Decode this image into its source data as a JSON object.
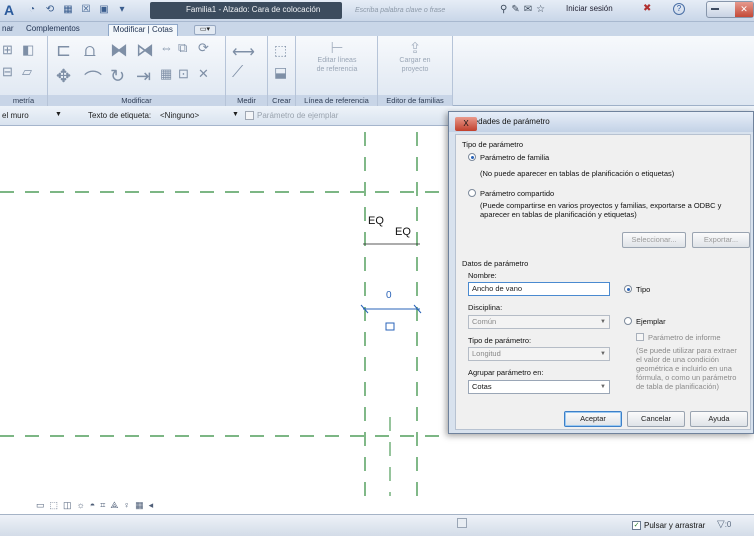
{
  "titlebar": {
    "app_letter": "A",
    "document_title": "Familia1 - Alzado: Cara de colocación",
    "search_placeholder": "Escriba palabra clave o frase",
    "signin_label": "Iniciar sesión",
    "help_label": "?"
  },
  "ribbon": {
    "tabs": [
      "nar",
      "Complementos",
      "Modificar | Cotas"
    ],
    "panels": [
      "metría",
      "Modificar",
      "Medir",
      "Crear",
      "Línea de referencia",
      "Editor de familias"
    ],
    "edit_lines_label_1": "Editar líneas",
    "edit_lines_label_2": "de referencia",
    "load_project_label_1": "Cargar en",
    "load_project_label_2": "proyecto"
  },
  "options_bar": {
    "first_select": "el muro",
    "label_text_label": "Texto de etiqueta:",
    "label_text_value": "<Ninguno>",
    "instance_param_label": "Parámetro de ejemplar"
  },
  "canvas": {
    "eq_label_1": "EQ",
    "eq_label_2": "EQ",
    "dim_value": "0"
  },
  "dialog": {
    "title": "Propiedades de parámetro",
    "close_label": "X",
    "param_type_group": "Tipo de parámetro",
    "family_param_label": "Parámetro de familia",
    "family_param_note": "(No puede aparecer en tablas de planificación o etiquetas)",
    "shared_param_label": "Parámetro compartido",
    "shared_param_note_1": "(Puede compartirse en varios proyectos y familias, exportarse a ODBC y",
    "shared_param_note_2": "aparecer en tablas de planificación y etiquetas)",
    "select_button": "Seleccionar...",
    "export_button": "Exportar...",
    "param_data_group": "Datos de parámetro",
    "name_label": "Nombre:",
    "name_value": "Ancho de vano",
    "type_radio_label": "Tipo",
    "discipline_label": "Disciplina:",
    "discipline_value": "Común",
    "instance_radio_label": "Ejemplar",
    "param_type_label": "Tipo de parámetro:",
    "param_type_value": "Longitud",
    "report_param_label": "Parámetro de informe",
    "report_note_1": "(Se puede utilizar para extraer",
    "report_note_2": "el valor de una condición",
    "report_note_3": "geométrica e incluirlo en una",
    "report_note_4": "fórmula, o como un parámetro",
    "report_note_5": "de tabla de planificación)",
    "group_label": "Agrupar parámetro en:",
    "group_value": "Cotas",
    "ok_button": "Aceptar",
    "cancel_button": "Cancelar",
    "help_button": "Ayuda"
  },
  "statusbar": {
    "press_drag_label": "Pulsar y arrastrar",
    "filter_count": ":0"
  }
}
